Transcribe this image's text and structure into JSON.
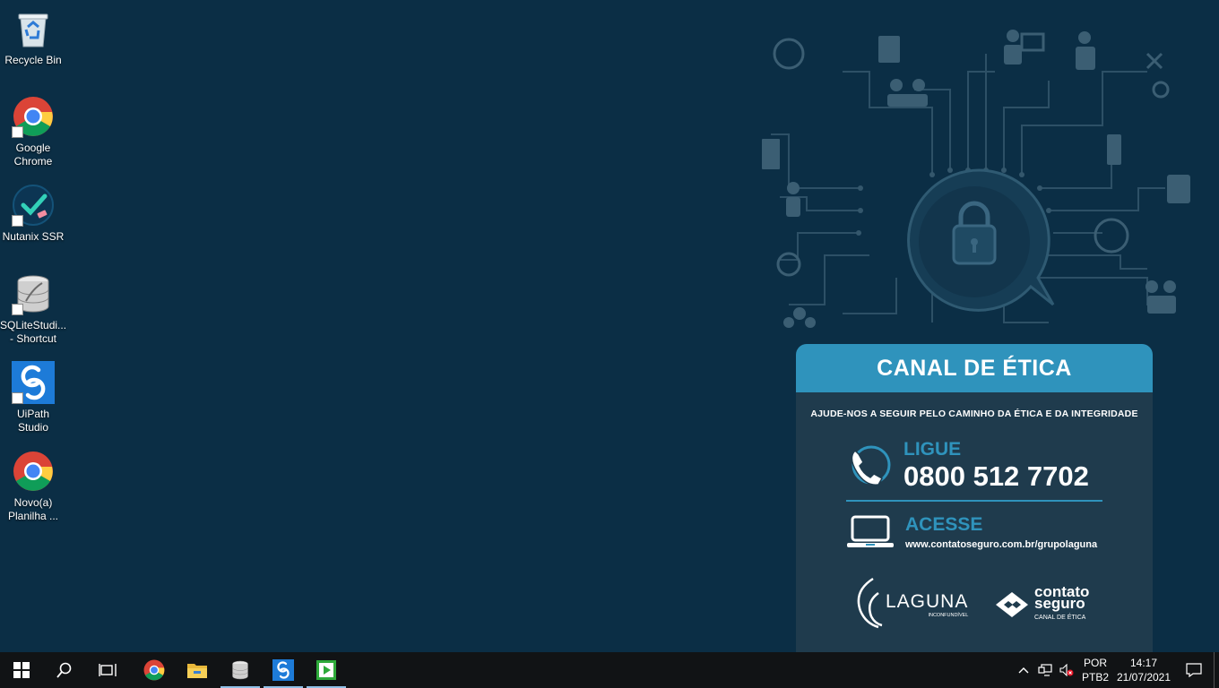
{
  "desktop": {
    "icons": [
      {
        "label": "Recycle Bin",
        "icon": "recycle-bin-icon",
        "shortcut": false
      },
      {
        "label": "Google\nChrome",
        "icon": "chrome-icon",
        "shortcut": true
      },
      {
        "label": "Nutanix SSR",
        "icon": "nutanix-icon",
        "shortcut": true
      },
      {
        "label": "SQLiteStudi...\n- Shortcut",
        "icon": "database-icon",
        "shortcut": true
      },
      {
        "label": "UiPath\nStudio",
        "icon": "uipath-icon",
        "shortcut": true
      },
      {
        "label": "Novo(a)\nPlanilha ...",
        "icon": "chrome-icon",
        "shortcut": false
      }
    ]
  },
  "wallpaper": {
    "title": "CANAL DE ÉTICA",
    "subtitle": "AJUDE-NOS A SEGUIR PELO CAMINHO DA ÉTICA E DA INTEGRIDADE",
    "call_label": "LIGUE",
    "phone": "0800 512 7702",
    "access_label": "ACESSE",
    "url": "www.contatoseguro.com.br/grupolaguna",
    "logo_laguna": "LAGUNA",
    "logo_laguna_tag": "INCONFUNDÍVEL",
    "logo_contato_1": "contato",
    "logo_contato_2": "seguro",
    "logo_contato_tag": "CANAL DE ÉTICA",
    "colors": {
      "background": "#0b2e45",
      "accent": "#2f93bc",
      "card": "#1f3b4d"
    }
  },
  "taskbar": {
    "pinned": [
      "start-icon",
      "search-icon",
      "task-view-icon",
      "chrome-icon",
      "file-explorer-icon",
      "database-icon",
      "uipath-icon",
      "player-icon"
    ],
    "language_1": "POR",
    "language_2": "PTB2",
    "time": "14:17",
    "date": "21/07/2021"
  }
}
